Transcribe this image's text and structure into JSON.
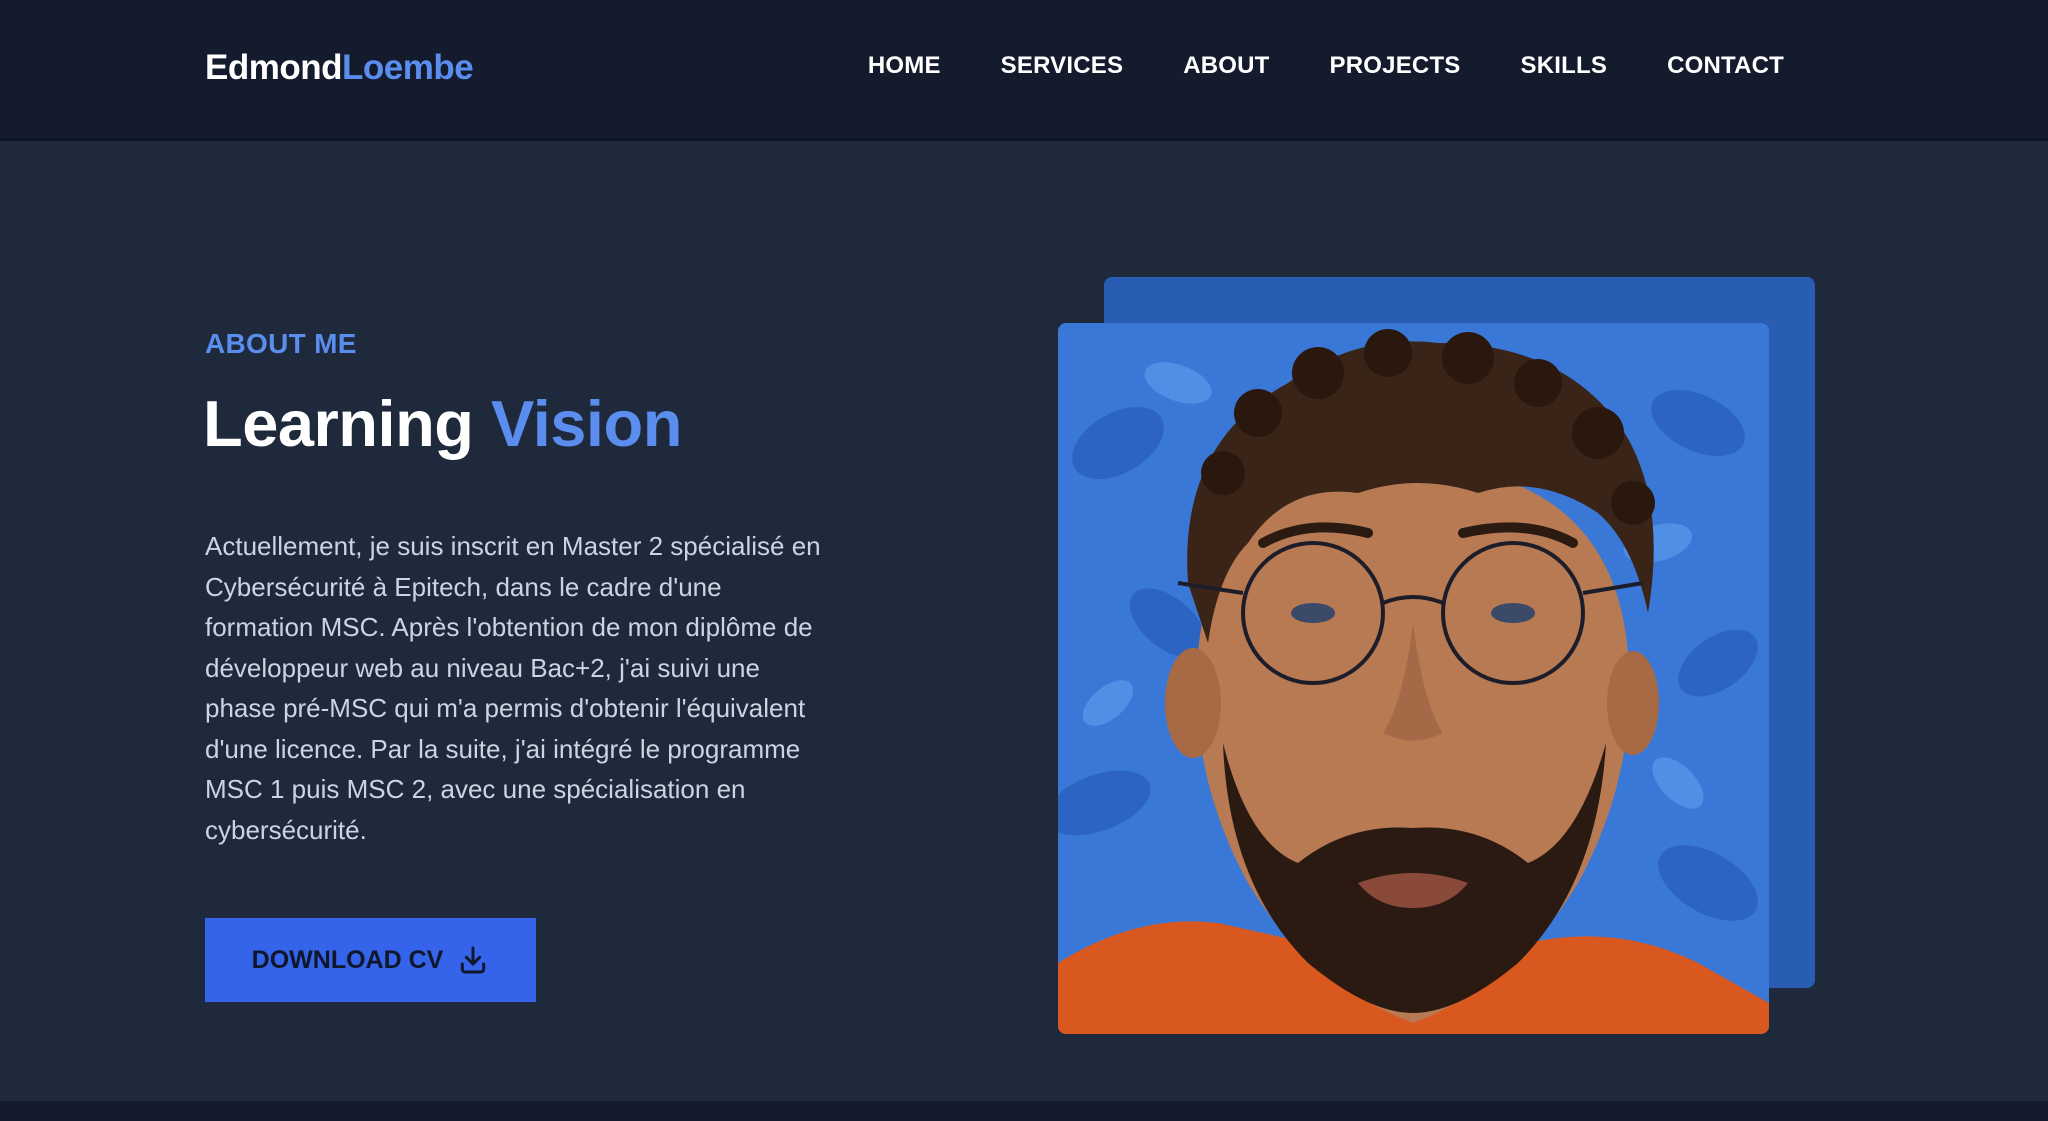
{
  "header": {
    "logo_first": "Edmond",
    "logo_last": "Loembe",
    "nav": [
      {
        "label": "HOME"
      },
      {
        "label": "SERVICES"
      },
      {
        "label": "ABOUT"
      },
      {
        "label": "PROJECTS"
      },
      {
        "label": "SKILLS"
      },
      {
        "label": "CONTACT"
      }
    ]
  },
  "about": {
    "eyebrow": "ABOUT ME",
    "title_main": "Learning",
    "title_accent": "Vision",
    "description": "Actuellement, je suis inscrit en Master 2 spécialisé en Cybersécurité à Epitech, dans le cadre d'une formation MSC. Après l'obtention de mon diplôme de développeur web au niveau Bac+2, j'ai suivi une phase pré-MSC qui m'a permis d'obtenir l'équivalent d'une licence. Par la suite, j'ai intégré le programme MSC 1 puis MSC 2, avec une spécialisation en cybersécurité.",
    "cv_button": "DOWNLOAD CV",
    "cv_icon": "download-icon"
  },
  "colors": {
    "accent": "#5b8def",
    "button": "#3563e9",
    "background": "#1e293b",
    "navbar": "#141b2d",
    "photo_frame": "#285db3"
  }
}
